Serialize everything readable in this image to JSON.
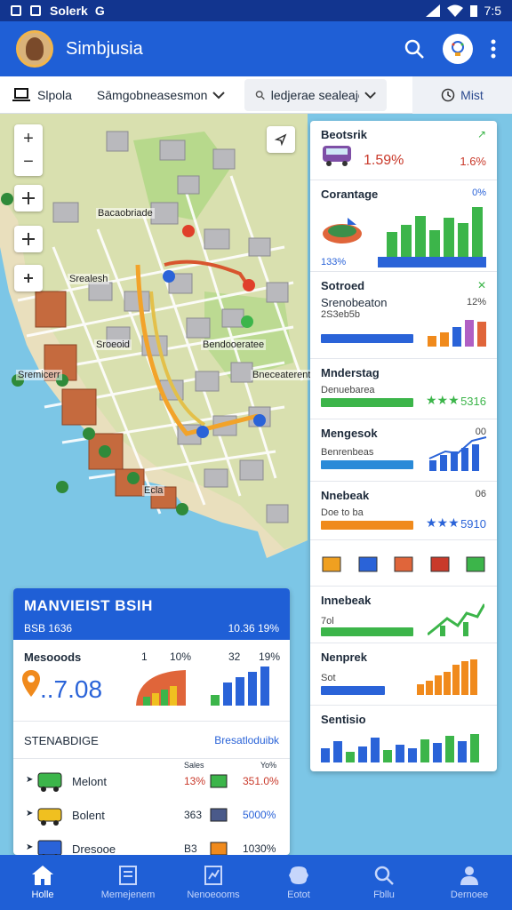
{
  "status_bar": {
    "app_name": "Solerk",
    "g_label": "G",
    "time": "7:5"
  },
  "app_bar": {
    "title": "Simbjusia"
  },
  "filter_bar": {
    "first_label": "Slpola",
    "second_label": "Sāmgobneasesmon",
    "search_placeholder": "ledjerae sealeaje",
    "list_label": "Mist"
  },
  "map": {
    "labels": {
      "l1": "Bacaobriade",
      "l2": "Srealesh",
      "l3": "Sroeoid",
      "l4": "Bendooeratee",
      "l5": "Sremicerr",
      "l6": "Bneceaterentee",
      "l7": "Ecla"
    }
  },
  "right_panel": {
    "c1": {
      "title": "Beotsrik",
      "value": "1.59%",
      "right": "1.6%"
    },
    "c2": {
      "title": "Corantage",
      "top_right": "0%",
      "value": "133%"
    },
    "c3": {
      "title": "Sotroed",
      "subtitle": "Srenobeaton",
      "sub2": "2S3eb5b",
      "top_right": "12%"
    },
    "c4": {
      "title": "Mnderstag",
      "small": "Denuebarea",
      "value": "5316"
    },
    "c5": {
      "title": "Mengesok",
      "small": "Benrenbeas",
      "top_right": "00"
    },
    "c6": {
      "title": "Nnebeak",
      "small": "Doe to ba",
      "top_right": "06",
      "value": "5910"
    },
    "c7": {
      "title": "Innebeak",
      "small": "7ol"
    },
    "c8": {
      "title": "Nenprek",
      "small": "Sot"
    },
    "c9": {
      "title": "Sentisio"
    }
  },
  "bl_panel": {
    "header": {
      "title": "MANVIEIST BSIH",
      "left": "BSB 1636",
      "right": "10.36 19%"
    },
    "metric": {
      "label": "Mesooods",
      "big_value": "..7.08",
      "col1": "1",
      "col2": "10%",
      "col3": "32",
      "col4": "19%"
    },
    "section": {
      "title": "STENABDIGE",
      "link": "Bresatloduibk"
    },
    "list_head": {
      "a": "Sales",
      "b": "Yo%"
    },
    "rows": [
      {
        "name": "Melont",
        "v1": "13%",
        "v2": "351.0%"
      },
      {
        "name": "Bolent",
        "v1": "363",
        "v2": "5000%"
      },
      {
        "name": "Dresooe",
        "v1": "B3",
        "v2": "1030%"
      }
    ]
  },
  "bottom_nav": [
    {
      "label": "Holle"
    },
    {
      "label": "Memejenem"
    },
    {
      "label": "Nenoeooms"
    },
    {
      "label": "Eotot"
    },
    {
      "label": "Fbllu"
    },
    {
      "label": "Dernoee"
    }
  ],
  "colors": {
    "primary": "#1f5fd6",
    "dark": "#12358f",
    "green": "#3cb54a",
    "orange": "#f08a1c",
    "red": "#e0402a",
    "blue": "#2a63d8"
  }
}
